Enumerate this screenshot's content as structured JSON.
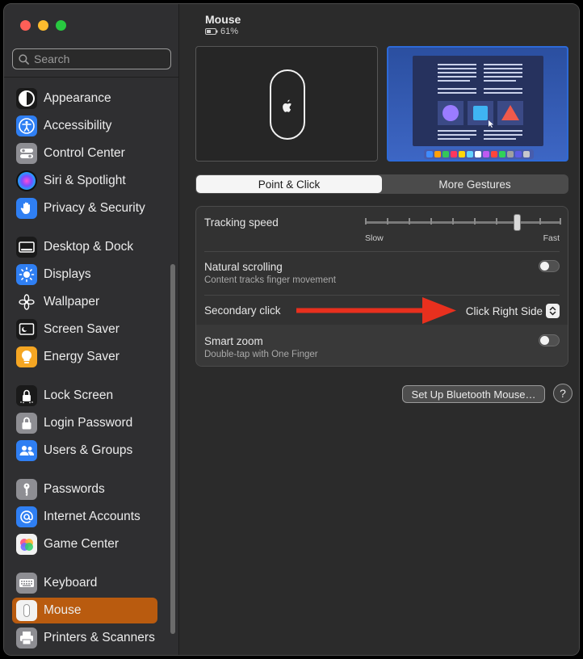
{
  "search": {
    "placeholder": "Search"
  },
  "sidebar": {
    "items": [
      {
        "label": "Appearance"
      },
      {
        "label": "Accessibility"
      },
      {
        "label": "Control Center"
      },
      {
        "label": "Siri & Spotlight"
      },
      {
        "label": "Privacy & Security"
      },
      {
        "label": "Desktop & Dock"
      },
      {
        "label": "Displays"
      },
      {
        "label": "Wallpaper"
      },
      {
        "label": "Screen Saver"
      },
      {
        "label": "Energy Saver"
      },
      {
        "label": "Lock Screen"
      },
      {
        "label": "Login Password"
      },
      {
        "label": "Users & Groups"
      },
      {
        "label": "Passwords"
      },
      {
        "label": "Internet Accounts"
      },
      {
        "label": "Game Center"
      },
      {
        "label": "Keyboard"
      },
      {
        "label": "Mouse"
      },
      {
        "label": "Printers & Scanners"
      }
    ],
    "selected": "Mouse"
  },
  "header": {
    "title": "Mouse",
    "battery": "61%",
    "battery_level": 0.61
  },
  "tabs": {
    "point_click": "Point & Click",
    "more_gestures": "More Gestures"
  },
  "settings": {
    "tracking_speed": {
      "label": "Tracking speed",
      "min_label": "Slow",
      "max_label": "Fast",
      "value": 0.78
    },
    "natural_scrolling": {
      "label": "Natural scrolling",
      "sub": "Content tracks finger movement",
      "on": false
    },
    "secondary_click": {
      "label": "Secondary click",
      "value": "Click Right Side"
    },
    "smart_zoom": {
      "label": "Smart zoom",
      "sub": "Double-tap with One Finger",
      "on": false
    }
  },
  "buttons": {
    "setup": "Set Up Bluetooth Mouse…",
    "help": "?"
  },
  "colors": {
    "accent_selected": "#b95b0f",
    "arrow": "#e8301e"
  }
}
